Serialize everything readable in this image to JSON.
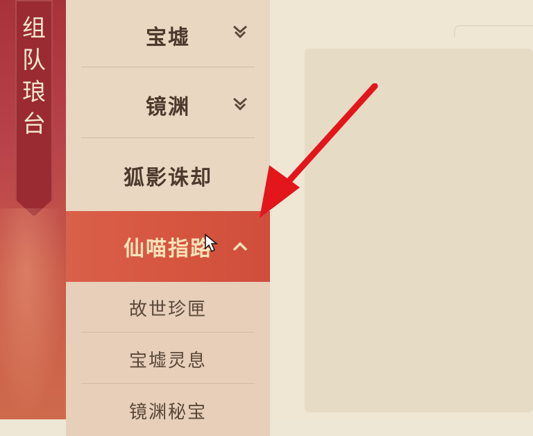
{
  "banner": {
    "title": "组\n队\n琅\n台"
  },
  "menu": {
    "items": [
      {
        "label": "宝墟",
        "icon": "double-chevron-down-icon",
        "state": "collapsed"
      },
      {
        "label": "镜渊",
        "icon": "double-chevron-down-icon",
        "state": "collapsed"
      },
      {
        "label": "狐影诛却"
      },
      {
        "label": "仙喵指路",
        "icon": "chevron-up-icon",
        "state": "expanded"
      }
    ],
    "subitems": [
      "故世珍匣",
      "宝墟灵息",
      "镜渊秘宝"
    ]
  },
  "colors": {
    "banner_red": "#a8323a",
    "active_item": "#d6553f",
    "active_text": "#fbe3b8",
    "annotation_arrow": "#e2161b"
  }
}
